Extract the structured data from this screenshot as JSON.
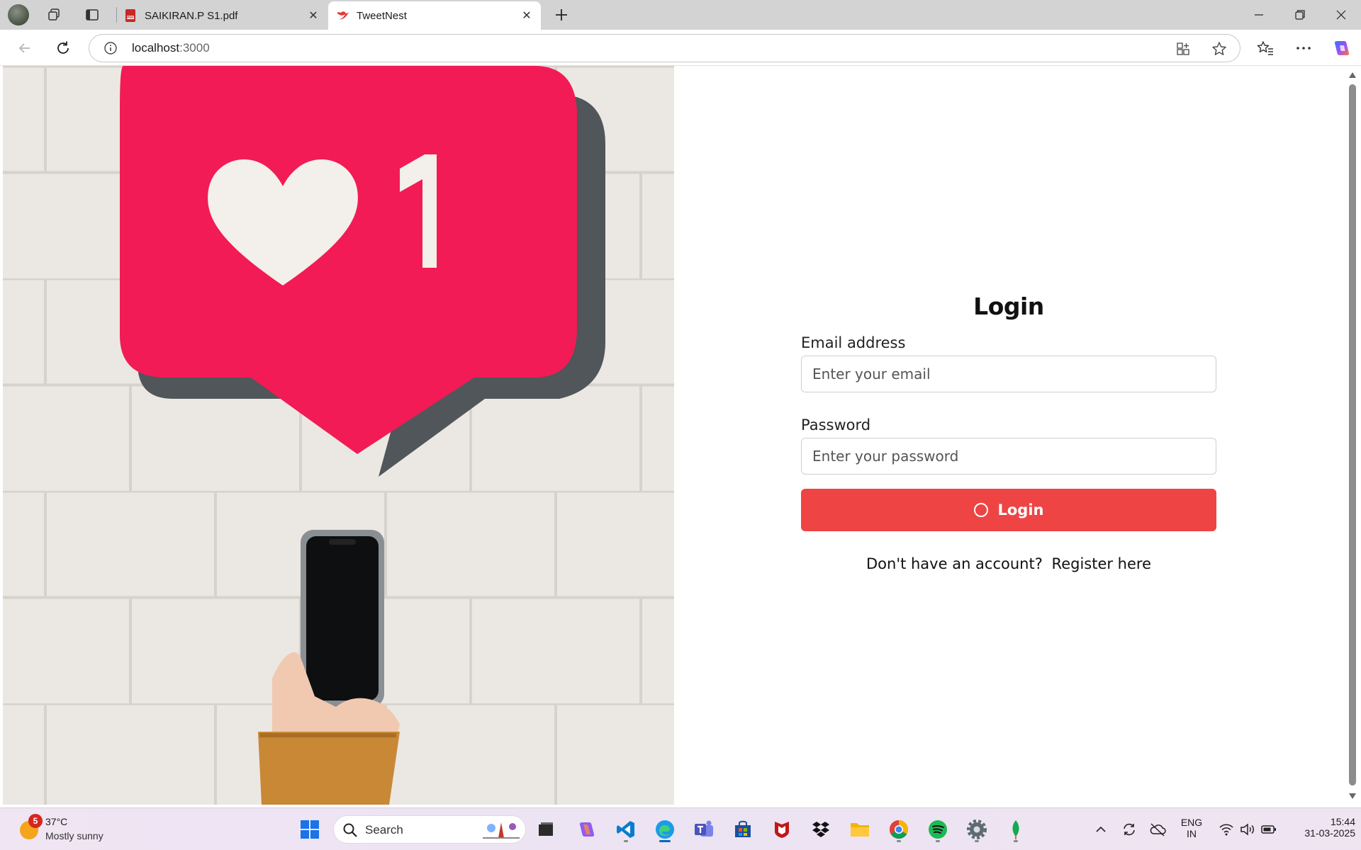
{
  "browser": {
    "tabs": [
      {
        "title": "SAIKIRAN.P S1.pdf",
        "active": false,
        "icon": "pdf-icon"
      },
      {
        "title": "TweetNest",
        "active": true,
        "icon": "tweetnest-bird-icon"
      }
    ],
    "address": {
      "host": "localhost",
      "port": ":3000"
    }
  },
  "login": {
    "title": "Login",
    "email_label": "Email address",
    "email_placeholder": "Enter your email",
    "password_label": "Password",
    "password_placeholder": "Enter your password",
    "button_label": "Login",
    "register_prompt": "Don't have an account?",
    "register_link": "Register here",
    "accent_color": "#ef4444"
  },
  "taskbar": {
    "weather_temp": "37°C",
    "weather_condition": "Mostly sunny",
    "weather_badge": "5",
    "search_label": "Search",
    "language_top": "ENG",
    "language_bottom": "IN",
    "time": "15:44",
    "date": "31-03-2025"
  }
}
